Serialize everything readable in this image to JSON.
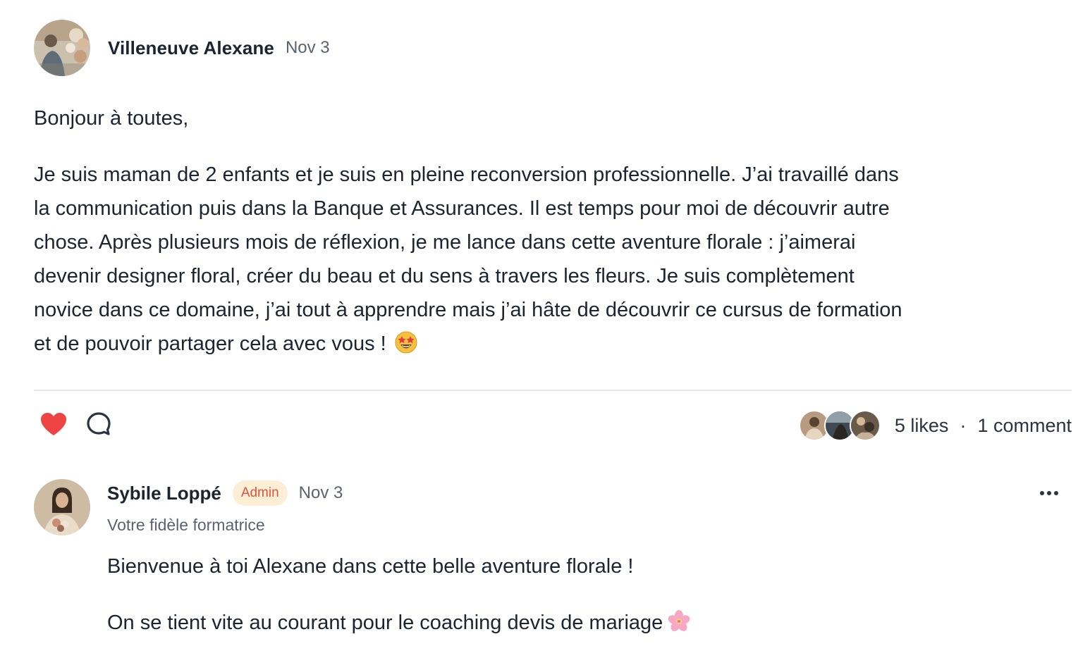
{
  "post": {
    "author": "Villeneuve Alexane",
    "date": "Nov 3",
    "avatar_icon": "avatar-florist-photo",
    "greeting": "Bonjour à toutes,",
    "body_lines": [
      "Je suis maman de 2 enfants et je suis en pleine reconversion professionnelle. J’ai travaillé dans",
      "la communication puis dans la Banque et Assurances. Il est temps pour moi de découvrir autre",
      "chose. Après plusieurs mois de réflexion, je me lance dans cette aventure florale : j’aimerai",
      "devenir designer floral, créer du beau et du sens à travers les fleurs. Je suis complètement",
      "novice dans ce domaine, j’ai tout à apprendre mais j’ai hâte de découvrir ce cursus de formation",
      "et de pouvoir partager cela avec vous !"
    ],
    "body_emoji": "star-struck-emoji"
  },
  "actions": {
    "like_icon": "heart-icon",
    "comment_icon": "comment-bubble-icon",
    "like_color": "#ef4444"
  },
  "engagement": {
    "likes": "5 likes",
    "separator": "·",
    "comments": "1 comment",
    "liker_avatars": [
      "liker-avatar-1",
      "liker-avatar-2",
      "liker-avatar-3"
    ]
  },
  "comment": {
    "author": "Sybile Loppé",
    "badge": "Admin",
    "badge_colors": {
      "background": "#fcefd6",
      "text": "#e2513a"
    },
    "date": "Nov 3",
    "role": "Votre fidèle formatrice",
    "more_icon": "more-horizontal-icon",
    "lines": [
      "Bienvenue à toi Alexane dans cette belle aventure florale !",
      "On se tient vite au courant pour le coaching devis de mariage"
    ],
    "emoji": "cherry-blossom-emoji"
  }
}
